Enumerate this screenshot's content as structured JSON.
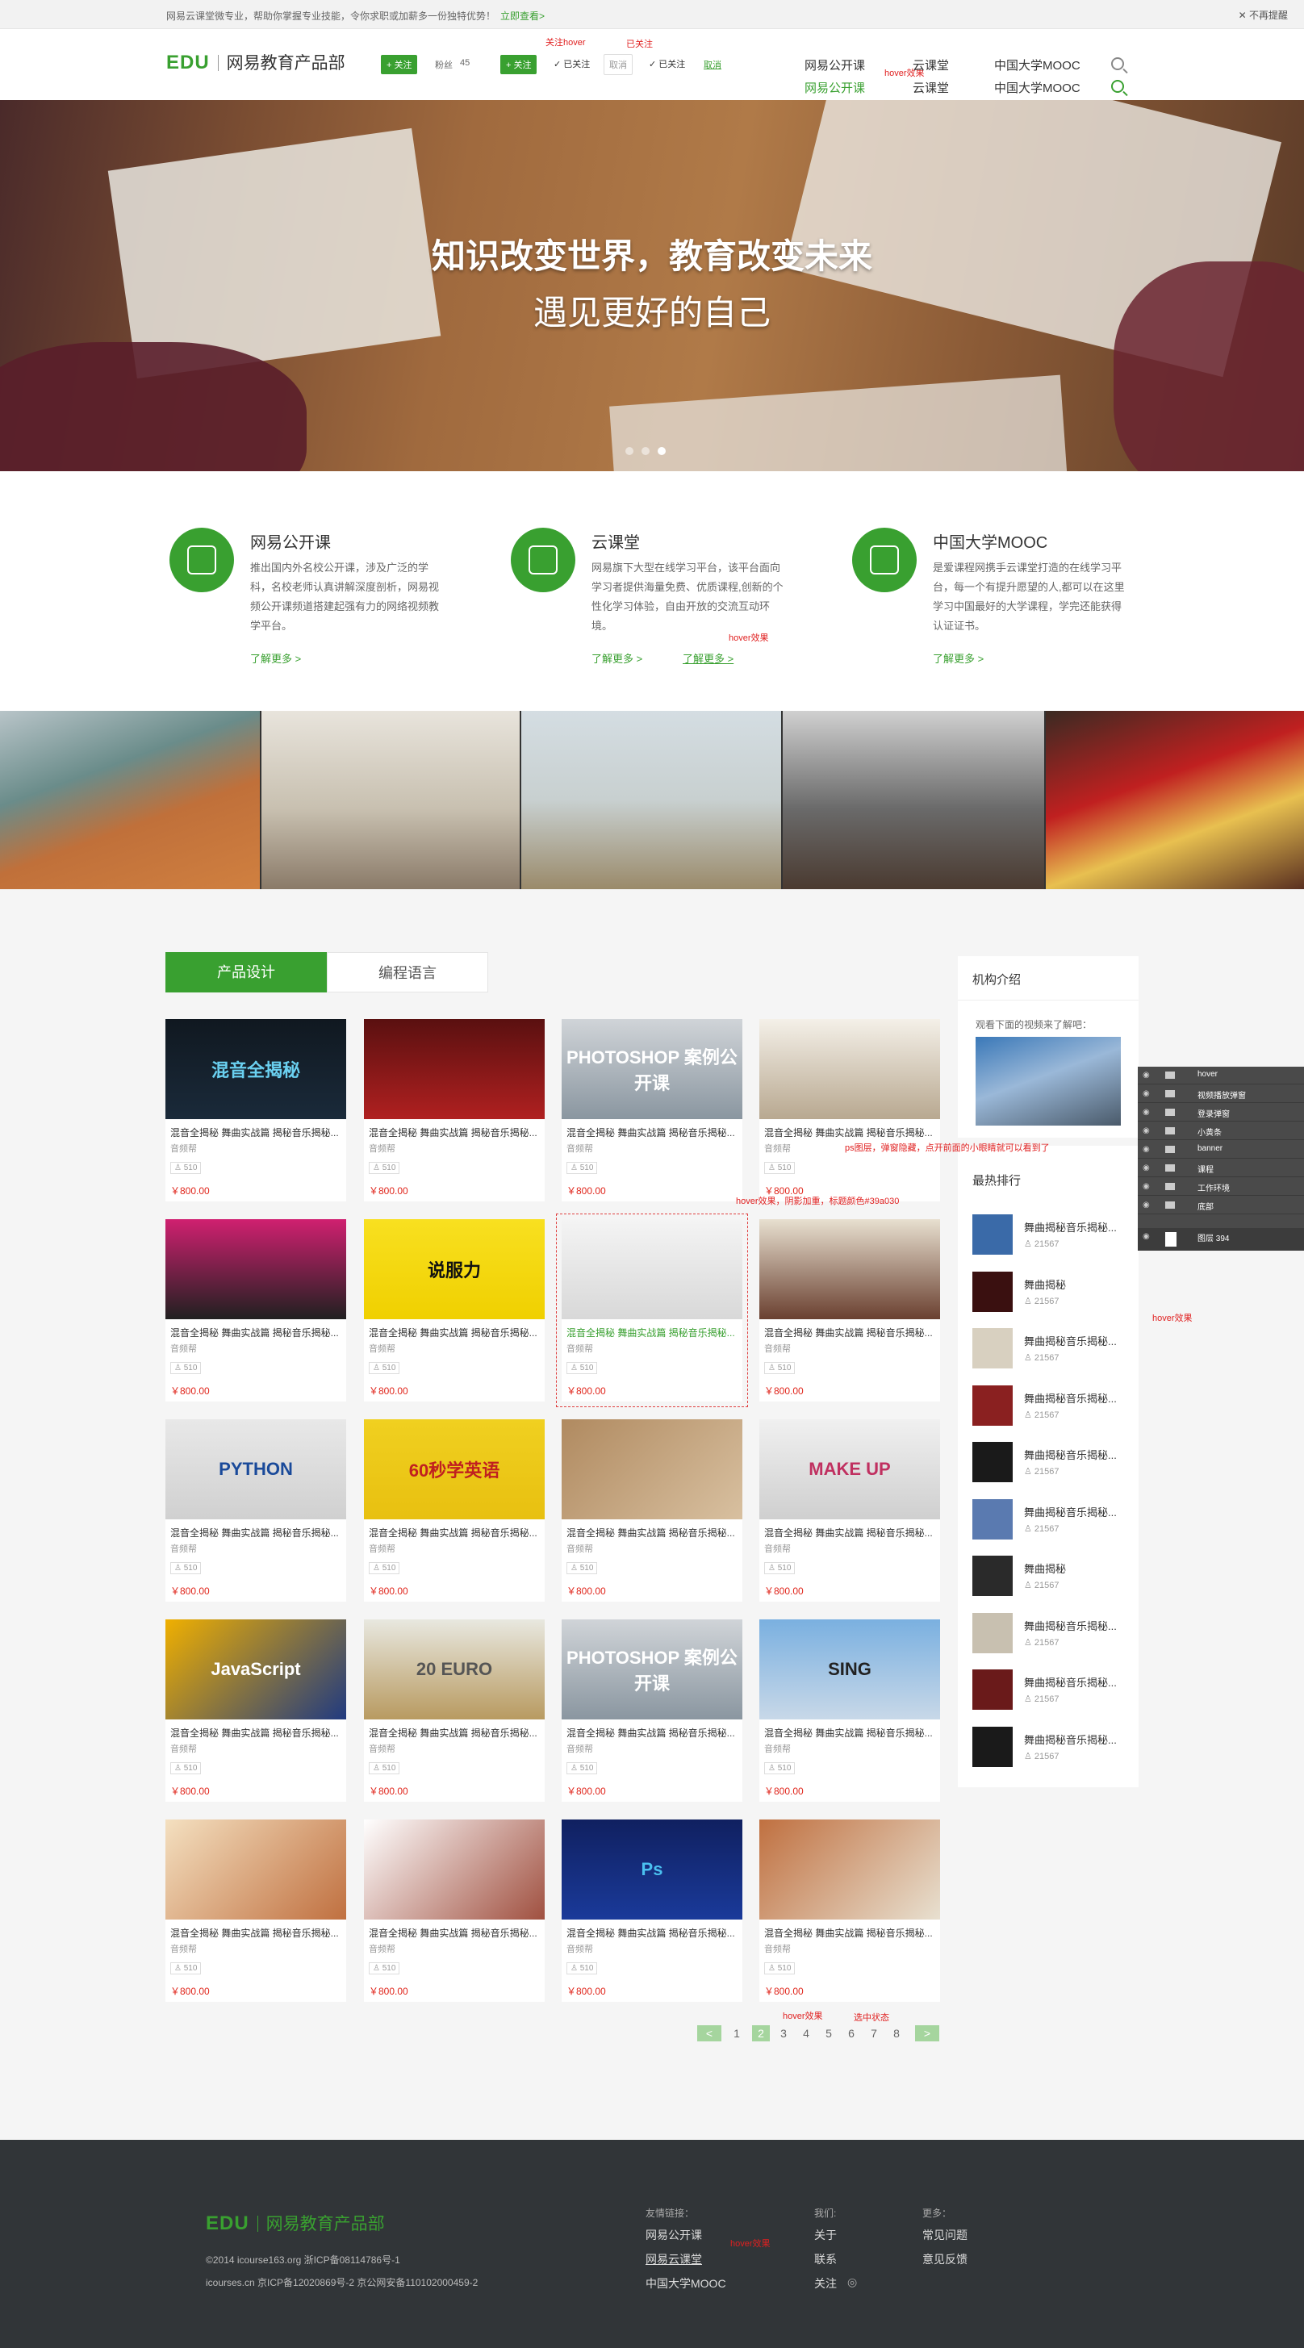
{
  "notice": {
    "text": "网易云课堂微专业，帮助你掌握专业技能，令你求职或加薪多一份独特优势！",
    "link": "立即查看>",
    "close": "不再提醒"
  },
  "header": {
    "logo_edu": "EDU",
    "logo_name": "网易教育产品部",
    "follow": "+ 关注",
    "fans_label": "粉丝",
    "fans_count": "45",
    "follow2": "+ 关注",
    "followed": "✓ 已关注",
    "cancel": "取消",
    "followed2": "✓ 已关注",
    "cancel2": "取消",
    "note_hover": "关注hover",
    "note_followed": "已关注",
    "note_nav_hover": "hover效果",
    "nav": [
      "网易公开课",
      "云课堂",
      "中国大学MOOC"
    ]
  },
  "banner": {
    "line1": "知识改变世界，教育改变未来",
    "line2": "遇见更好的自己"
  },
  "intro": [
    {
      "title": "网易公开课",
      "desc": "推出国内外名校公开课，涉及广泛的学科，名校老师认真讲解深度剖析，网易视频公开课频道搭建起强有力的网络视频教学平台。",
      "more": "了解更多 >"
    },
    {
      "title": "云课堂",
      "desc": "网易旗下大型在线学习平台，该平台面向学习者提供海量免费、优质课程,创新的个性化学习体验，自由开放的交流互动环境。",
      "more": "了解更多 >",
      "more_hover": "了解更多 >",
      "note": "hover效果"
    },
    {
      "title": "中国大学MOOC",
      "desc": "是爱课程网携手云课堂打造的在线学习平台，每一个有提升愿望的人,都可以在这里学习中国最好的大学课程，学完还能获得认证证书。",
      "more": "了解更多 >"
    }
  ],
  "tabs": [
    "产品设计",
    "编程语言"
  ],
  "course": {
    "title": "混音全揭秘 舞曲实战篇 揭秘音乐揭秘...",
    "cat": "音频帮",
    "num": "510",
    "price": "￥800.00"
  },
  "card_imgs": [
    "混音全揭秘",
    "",
    "PHOTOSHOP 案例公开课",
    "",
    "",
    "说服力",
    "",
    "",
    "PYTHON",
    "60秒学英语",
    "",
    "MAKE UP",
    "JavaScript",
    "20 EURO",
    "PHOTOSHOP 案例公开课",
    "SING",
    "",
    "",
    "Ps",
    ""
  ],
  "card_note": "hover效果，阴影加重，标题颜色#39a030",
  "pager": {
    "prev": "<",
    "next": ">",
    "pages": [
      "1",
      "2",
      "3",
      "4",
      "5",
      "6",
      "7",
      "8"
    ],
    "note_hover": "hover效果",
    "note_active": "选中状态"
  },
  "sidebar": {
    "intro_title": "机构介绍",
    "intro_sub": "观看下面的视频来了解吧：",
    "rank_title": "最热排行",
    "rank_items": [
      {
        "t": "舞曲揭秘音乐揭秘...",
        "n": "21567"
      },
      {
        "t": "舞曲揭秘",
        "n": "21567"
      },
      {
        "t": "舞曲揭秘音乐揭秘...",
        "n": "21567"
      },
      {
        "t": "舞曲揭秘音乐揭秘...",
        "n": "21567"
      },
      {
        "t": "舞曲揭秘音乐揭秘...",
        "n": "21567"
      },
      {
        "t": "舞曲揭秘音乐揭秘...",
        "n": "21567"
      },
      {
        "t": "舞曲揭秘",
        "n": "21567"
      },
      {
        "t": "舞曲揭秘音乐揭秘...",
        "n": "21567"
      },
      {
        "t": "舞曲揭秘音乐揭秘...",
        "n": "21567"
      },
      {
        "t": "舞曲揭秘音乐揭秘...",
        "n": "21567"
      }
    ],
    "ps_note": "ps图层，弹窗隐藏，点开前面的小眼睛就可以看到了",
    "hover_note": "hover效果"
  },
  "ps_layers": [
    "hover",
    "视频播放弹窗",
    "登录弹窗",
    "小黄条",
    "banner",
    "课程",
    "工作环境",
    "底部",
    "图层 394"
  ],
  "footer": {
    "logo_edu": "EDU",
    "logo_name": "网易教育产品部",
    "copy1": "©2014 icourse163.org 浙ICP备08114786号-1",
    "copy2": "icourses.cn 京ICP备12020869号-2 京公网安备110102000459-2",
    "links_title": "友情链接：",
    "links": [
      "网易公开课",
      "网易云课堂",
      "中国大学MOOC"
    ],
    "links_note": "hover效果",
    "we_title": "我们:",
    "we": [
      "关于",
      "联系",
      "关注"
    ],
    "more_title": "更多：",
    "more": [
      "常见问题",
      "意见反馈"
    ]
  },
  "colors": {
    "accent": "#39a030",
    "price": "#e0251b",
    "footer_bg": "#313538",
    "note": "#e02020"
  }
}
